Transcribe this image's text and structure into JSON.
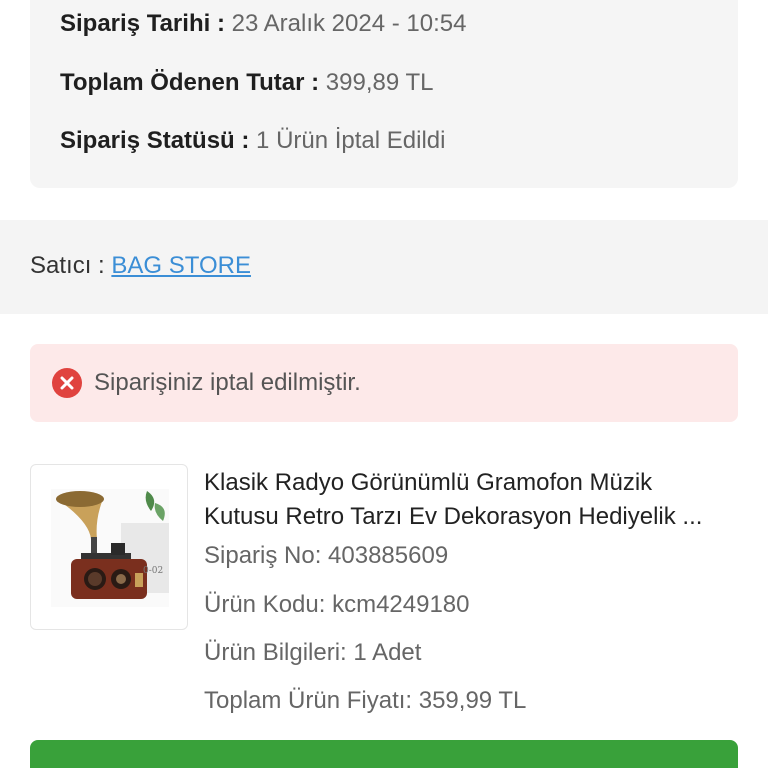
{
  "order_summary": {
    "date_label": "Sipariş Tarihi :",
    "date_value": "23 Aralık 2024 - 10:54",
    "total_label": "Toplam Ödenen Tutar :",
    "total_value": "399,89 TL",
    "status_label": "Sipariş Statüsü :",
    "status_value": "1 Ürün İptal Edildi"
  },
  "seller": {
    "label": "Satıcı :",
    "name": "BAG STORE"
  },
  "alert": {
    "icon": "error-x-icon",
    "color": "#e0433f",
    "text": "Siparişiniz iptal edilmiştir."
  },
  "product": {
    "image_icon": "gramophone-product-image",
    "title_line1": "Klasik Radyo Görünümlü Gramofon Müzik",
    "title_line2": "Kutusu Retro Tarzı Ev Dekorasyon Hediyelik ...",
    "order_no": "Sipariş No: 403885609",
    "product_code": "Ürün Kodu: kcm4249180",
    "product_info": "Ürün Bilgileri: 1 Adet",
    "total_price": "Toplam Ürün Fiyatı: 359,99 TL"
  },
  "colors": {
    "link": "#3b8ed6",
    "button": "#39a13a",
    "alert_bg": "#fde9e9"
  }
}
